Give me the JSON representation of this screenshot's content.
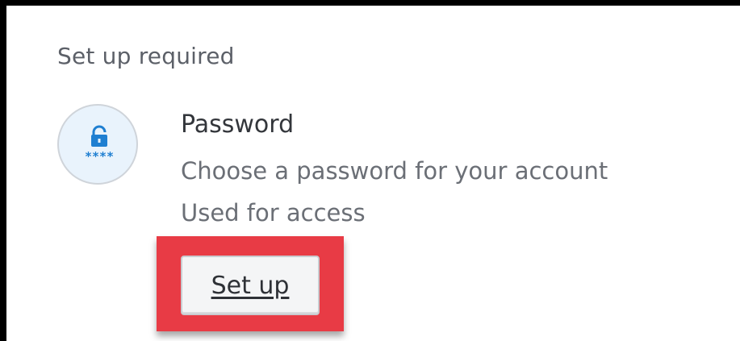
{
  "section": {
    "title": "Set up required"
  },
  "factor": {
    "icon": "password-lock-icon",
    "name": "Password",
    "description_lines": [
      "Choose a password for your account",
      "Used for access"
    ],
    "setup_label": "Set up"
  },
  "colors": {
    "highlight": "#e83b45",
    "icon_accent": "#1f7fd1",
    "icon_bg": "#e9f3fc"
  }
}
